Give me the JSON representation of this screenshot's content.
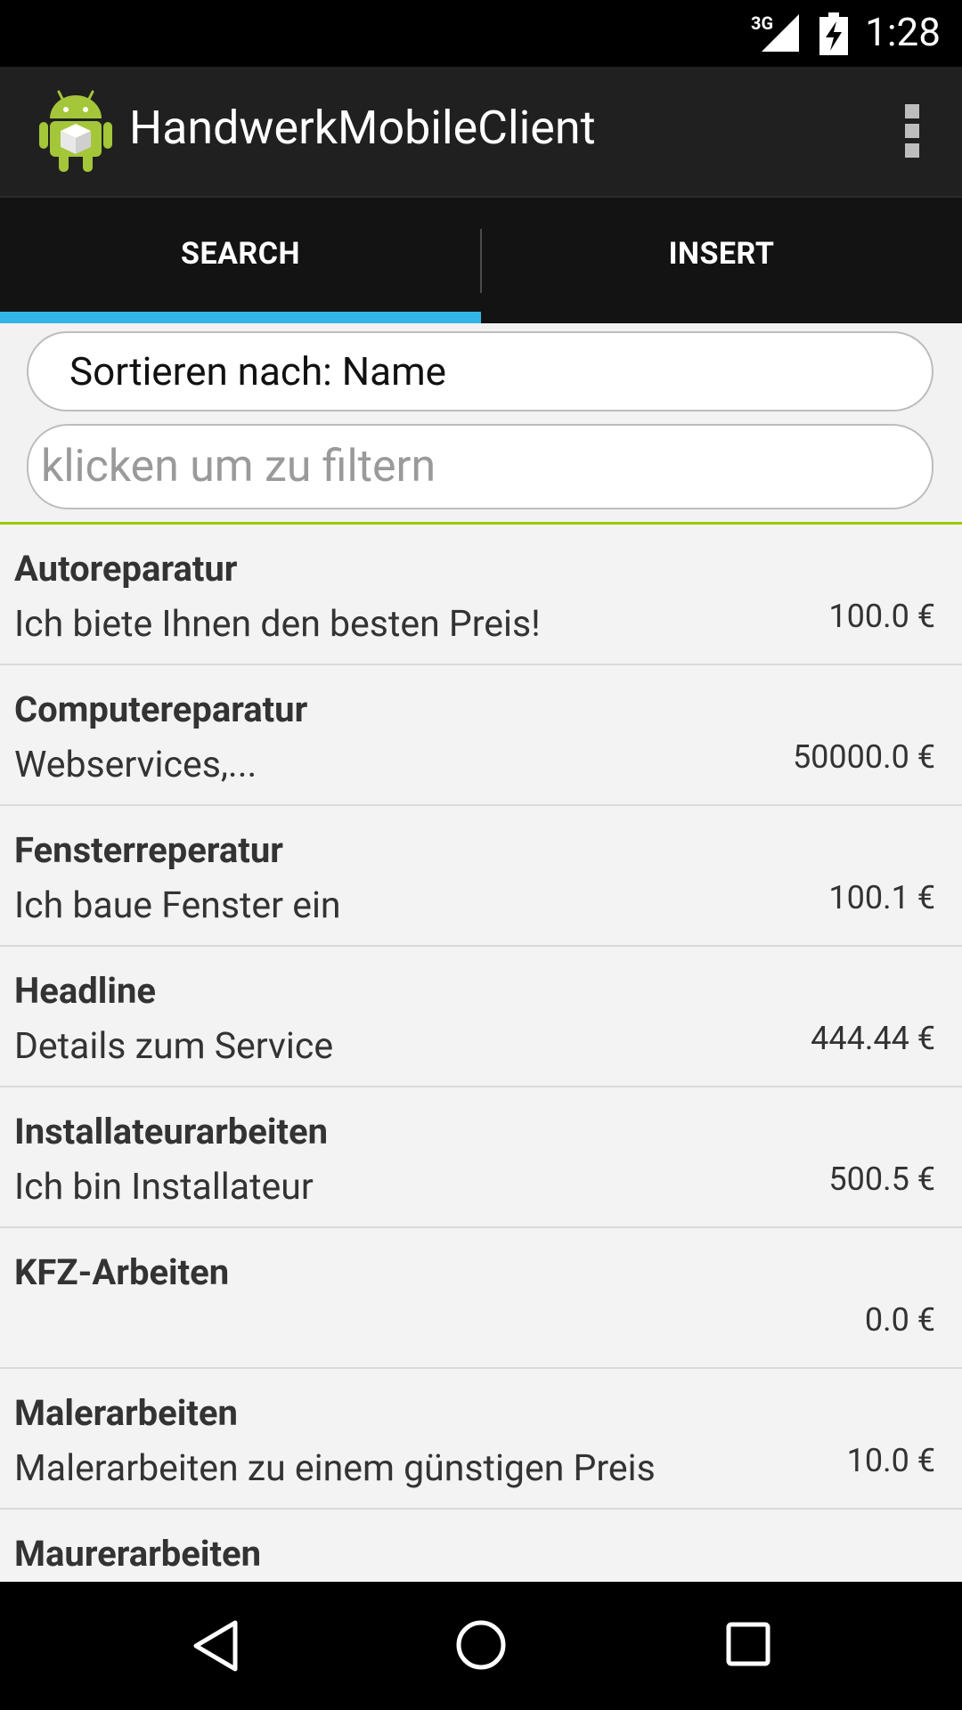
{
  "status_bar": {
    "network": "3G",
    "time": "1:28"
  },
  "action_bar": {
    "title": "HandwerkMobileClient"
  },
  "tabs": [
    {
      "label": "SEARCH",
      "selected": true
    },
    {
      "label": "INSERT",
      "selected": false
    }
  ],
  "filter": {
    "sort_label": "Sortieren nach: Name",
    "filter_placeholder": "klicken um zu filtern"
  },
  "colors": {
    "tab_indicator": "#33b5e5",
    "filter_underline": "#99cc00",
    "android_green": "#a4c639"
  },
  "items": [
    {
      "title": "Autoreparatur",
      "description": "Ich biete Ihnen den besten Preis!",
      "price": "100.0 €"
    },
    {
      "title": "Computereparatur",
      "description": "Webservices,...",
      "price": "50000.0 €"
    },
    {
      "title": "Fensterreperatur",
      "description": "Ich baue Fenster ein",
      "price": "100.1 €"
    },
    {
      "title": "Headline",
      "description": "Details zum Service",
      "price": "444.44 €"
    },
    {
      "title": "Installateurarbeiten",
      "description": "Ich bin Installateur",
      "price": "500.5 €"
    },
    {
      "title": "KFZ-Arbeiten",
      "description": "",
      "price": "0.0 €"
    },
    {
      "title": "Malerarbeiten",
      "description": "Malerarbeiten zu einem günstigen Preis",
      "price": "10.0 €"
    },
    {
      "title": "Maurerarbeiten",
      "description": "",
      "price": ""
    }
  ],
  "icons": {
    "signal": "signal-icon",
    "battery": "battery-charging-icon",
    "app": "android-app-icon",
    "overflow": "overflow-menu-icon",
    "back": "back-icon",
    "home": "home-icon",
    "recents": "recents-icon"
  }
}
